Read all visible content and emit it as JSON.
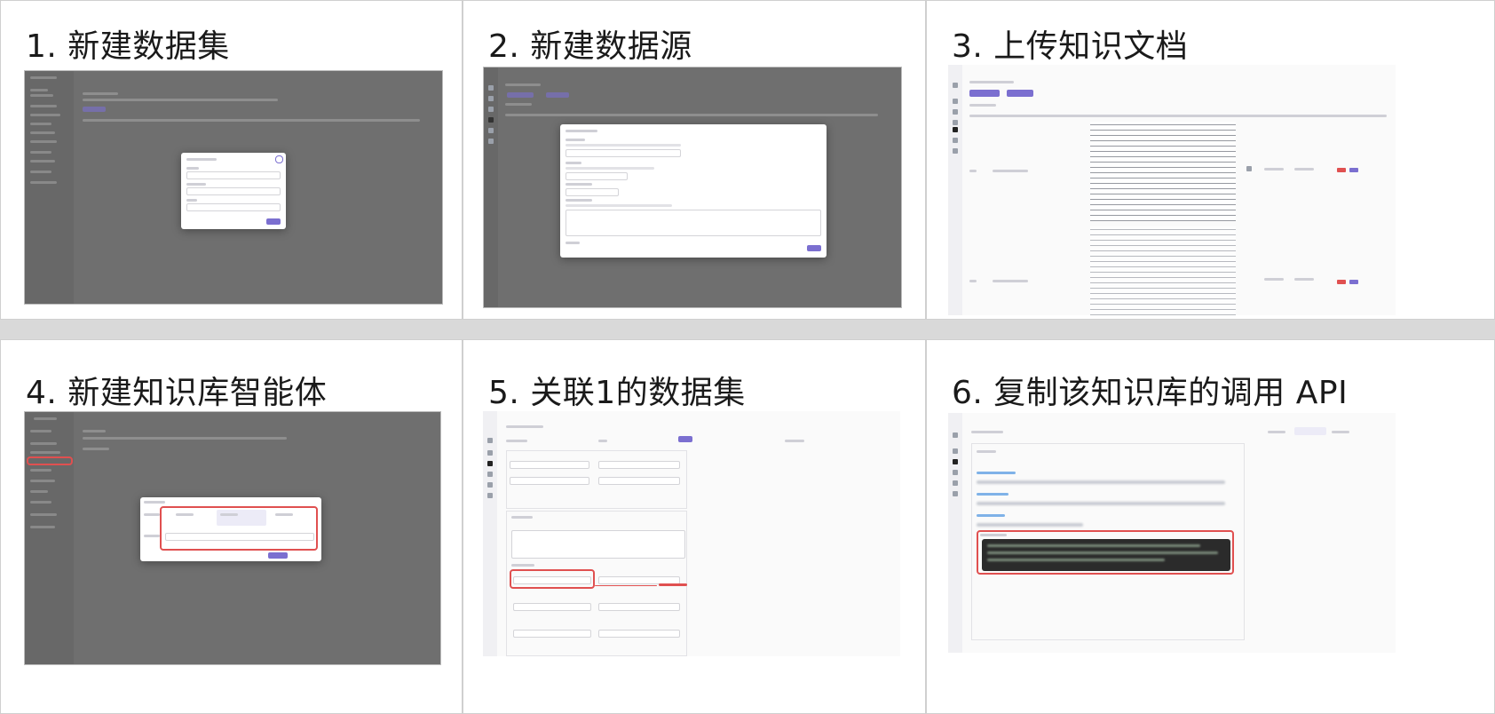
{
  "steps": [
    {
      "title": "1. 新建数据集"
    },
    {
      "title": "2. 新建数据源"
    },
    {
      "title": "3. 上传知识文档"
    },
    {
      "title": "4. 新建知识库智能体"
    },
    {
      "title": "5. 关联1的数据集"
    },
    {
      "title": "6. 复制该知识库的调用 API"
    }
  ],
  "colors": {
    "accent": "#7b6fd0",
    "highlight": "#e05050",
    "overlay": "#6f6f6f"
  }
}
